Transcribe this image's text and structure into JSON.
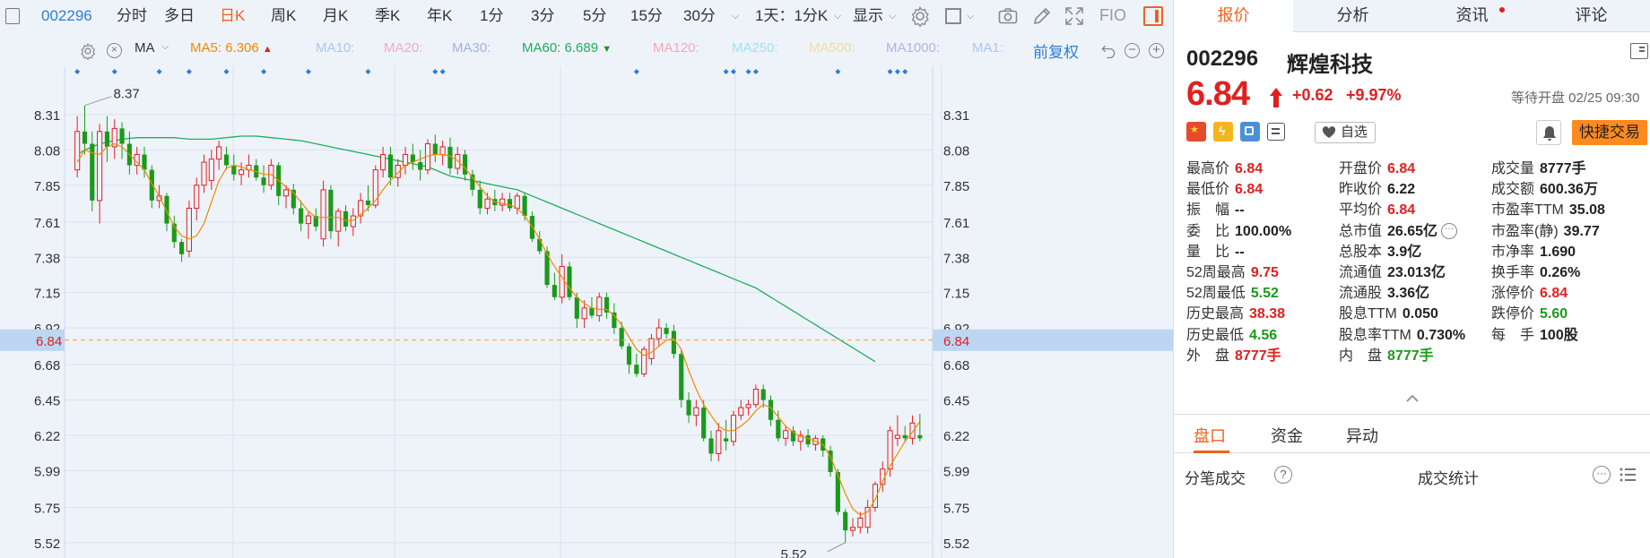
{
  "toolbar": {
    "code": "002296",
    "periods": [
      "分时",
      "多日",
      "日K",
      "周K",
      "月K",
      "季K",
      "年K",
      "1分",
      "3分",
      "5分",
      "15分",
      "30分"
    ],
    "active_period": "日K",
    "span_label": "1天：1分K",
    "display_label": "显示",
    "fio_label": "FIO"
  },
  "ma_row": {
    "label": "MA",
    "items": [
      {
        "label": "MA5:",
        "value": "6.306",
        "color": "#f08a00",
        "trend": "up"
      },
      {
        "label": "MA10:",
        "value": "",
        "color": "#a9c8ee"
      },
      {
        "label": "MA20:",
        "value": "",
        "color": "#f2a8c8"
      },
      {
        "label": "MA30:",
        "value": "",
        "color": "#9fb4dc"
      },
      {
        "label": "MA60:",
        "value": "6.689",
        "color": "#1fae5c",
        "trend": "down"
      },
      {
        "label": "MA120:",
        "value": "",
        "color": "#f2a8b8"
      },
      {
        "label": "MA250:",
        "value": "",
        "color": "#a0e0f0"
      },
      {
        "label": "MA500:",
        "value": "",
        "color": "#f0dca0"
      },
      {
        "label": "MA1000:",
        "value": "",
        "color": "#b8b0e0"
      },
      {
        "label": "MA1:",
        "value": "",
        "color": "#a9c8ee"
      }
    ],
    "adjust_label": "前复权"
  },
  "chart_data": {
    "type": "candlestick",
    "y_ticks": [
      "8.31",
      "8.08",
      "7.85",
      "7.61",
      "7.38",
      "7.15",
      "6.92",
      "6.68",
      "6.45",
      "6.22",
      "5.99",
      "5.75",
      "5.52"
    ],
    "ylim": [
      5.42,
      8.45
    ],
    "current_price": "6.84",
    "high_marker": "8.37",
    "low_marker": "5.52",
    "grid": true,
    "up_color": "#e02020",
    "down_color": "#1a9a1a",
    "candles": [
      {
        "o": 7.95,
        "h": 8.3,
        "l": 7.9,
        "c": 8.2
      },
      {
        "o": 8.2,
        "h": 8.37,
        "l": 8.05,
        "c": 8.12
      },
      {
        "o": 8.12,
        "h": 8.2,
        "l": 7.68,
        "c": 7.75
      },
      {
        "o": 7.75,
        "h": 8.25,
        "l": 7.6,
        "c": 8.2
      },
      {
        "o": 8.2,
        "h": 8.3,
        "l": 8.0,
        "c": 8.1
      },
      {
        "o": 8.1,
        "h": 8.28,
        "l": 8.02,
        "c": 8.22
      },
      {
        "o": 8.22,
        "h": 8.26,
        "l": 8.02,
        "c": 8.12
      },
      {
        "o": 8.12,
        "h": 8.2,
        "l": 7.92,
        "c": 7.98
      },
      {
        "o": 7.98,
        "h": 8.1,
        "l": 7.92,
        "c": 8.05
      },
      {
        "o": 8.05,
        "h": 8.1,
        "l": 7.9,
        "c": 7.95
      },
      {
        "o": 7.95,
        "h": 7.98,
        "l": 7.7,
        "c": 7.75
      },
      {
        "o": 7.75,
        "h": 7.85,
        "l": 7.7,
        "c": 7.78
      },
      {
        "o": 7.78,
        "h": 7.8,
        "l": 7.55,
        "c": 7.6
      },
      {
        "o": 7.6,
        "h": 7.65,
        "l": 7.44,
        "c": 7.48
      },
      {
        "o": 7.48,
        "h": 7.5,
        "l": 7.35,
        "c": 7.4
      },
      {
        "o": 7.42,
        "h": 7.75,
        "l": 7.38,
        "c": 7.7
      },
      {
        "o": 7.7,
        "h": 7.9,
        "l": 7.62,
        "c": 7.85
      },
      {
        "o": 7.85,
        "h": 8.05,
        "l": 7.8,
        "c": 8.0
      },
      {
        "o": 7.88,
        "h": 8.08,
        "l": 7.82,
        "c": 8.02
      },
      {
        "o": 8.02,
        "h": 8.14,
        "l": 7.95,
        "c": 8.1
      },
      {
        "o": 8.05,
        "h": 8.1,
        "l": 7.95,
        "c": 7.98
      },
      {
        "o": 7.98,
        "h": 8.05,
        "l": 7.88,
        "c": 7.92
      },
      {
        "o": 7.92,
        "h": 8.0,
        "l": 7.85,
        "c": 7.95
      },
      {
        "o": 7.95,
        "h": 8.05,
        "l": 7.9,
        "c": 7.98
      },
      {
        "o": 7.98,
        "h": 8.02,
        "l": 7.88,
        "c": 7.9
      },
      {
        "o": 7.9,
        "h": 7.98,
        "l": 7.8,
        "c": 7.85
      },
      {
        "o": 7.85,
        "h": 8.02,
        "l": 7.82,
        "c": 7.98
      },
      {
        "o": 7.98,
        "h": 8.0,
        "l": 7.72,
        "c": 7.78
      },
      {
        "o": 7.78,
        "h": 7.85,
        "l": 7.7,
        "c": 7.82
      },
      {
        "o": 7.82,
        "h": 7.86,
        "l": 7.66,
        "c": 7.7
      },
      {
        "o": 7.7,
        "h": 7.75,
        "l": 7.55,
        "c": 7.6
      },
      {
        "o": 7.6,
        "h": 7.68,
        "l": 7.5,
        "c": 7.65
      },
      {
        "o": 7.65,
        "h": 7.7,
        "l": 7.55,
        "c": 7.58
      },
      {
        "o": 7.5,
        "h": 7.88,
        "l": 7.45,
        "c": 7.82
      },
      {
        "o": 7.82,
        "h": 7.85,
        "l": 7.5,
        "c": 7.55
      },
      {
        "o": 7.55,
        "h": 7.7,
        "l": 7.45,
        "c": 7.68
      },
      {
        "o": 7.68,
        "h": 7.72,
        "l": 7.55,
        "c": 7.58
      },
      {
        "o": 7.58,
        "h": 7.7,
        "l": 7.52,
        "c": 7.65
      },
      {
        "o": 7.65,
        "h": 7.8,
        "l": 7.6,
        "c": 7.75
      },
      {
        "o": 7.75,
        "h": 7.85,
        "l": 7.68,
        "c": 7.72
      },
      {
        "o": 7.72,
        "h": 7.98,
        "l": 7.7,
        "c": 7.95
      },
      {
        "o": 7.95,
        "h": 8.1,
        "l": 7.9,
        "c": 8.05
      },
      {
        "o": 8.05,
        "h": 8.1,
        "l": 7.85,
        "c": 7.9
      },
      {
        "o": 7.9,
        "h": 8.02,
        "l": 7.84,
        "c": 7.98
      },
      {
        "o": 7.98,
        "h": 8.1,
        "l": 7.92,
        "c": 8.05
      },
      {
        "o": 8.05,
        "h": 8.12,
        "l": 7.95,
        "c": 8.0
      },
      {
        "o": 8.0,
        "h": 8.08,
        "l": 7.88,
        "c": 7.95
      },
      {
        "o": 7.95,
        "h": 8.15,
        "l": 7.92,
        "c": 8.12
      },
      {
        "o": 8.12,
        "h": 8.18,
        "l": 8.0,
        "c": 8.05
      },
      {
        "o": 8.05,
        "h": 8.14,
        "l": 7.98,
        "c": 8.1
      },
      {
        "o": 8.1,
        "h": 8.16,
        "l": 7.92,
        "c": 7.96
      },
      {
        "o": 7.96,
        "h": 8.1,
        "l": 7.92,
        "c": 8.05
      },
      {
        "o": 8.05,
        "h": 8.08,
        "l": 7.88,
        "c": 7.92
      },
      {
        "o": 7.92,
        "h": 7.95,
        "l": 7.78,
        "c": 7.82
      },
      {
        "o": 7.82,
        "h": 7.88,
        "l": 7.66,
        "c": 7.7
      },
      {
        "o": 7.7,
        "h": 7.8,
        "l": 7.66,
        "c": 7.76
      },
      {
        "o": 7.76,
        "h": 7.82,
        "l": 7.68,
        "c": 7.72
      },
      {
        "o": 7.72,
        "h": 7.8,
        "l": 7.68,
        "c": 7.76
      },
      {
        "o": 7.76,
        "h": 7.8,
        "l": 7.68,
        "c": 7.7
      },
      {
        "o": 7.7,
        "h": 7.8,
        "l": 7.66,
        "c": 7.78
      },
      {
        "o": 7.78,
        "h": 7.8,
        "l": 7.62,
        "c": 7.65
      },
      {
        "o": 7.65,
        "h": 7.68,
        "l": 7.48,
        "c": 7.5
      },
      {
        "o": 7.5,
        "h": 7.55,
        "l": 7.4,
        "c": 7.42
      },
      {
        "o": 7.42,
        "h": 7.45,
        "l": 7.18,
        "c": 7.2
      },
      {
        "o": 7.2,
        "h": 7.28,
        "l": 7.1,
        "c": 7.12
      },
      {
        "o": 7.12,
        "h": 7.4,
        "l": 7.08,
        "c": 7.32
      },
      {
        "o": 7.32,
        "h": 7.35,
        "l": 7.1,
        "c": 7.12
      },
      {
        "o": 7.12,
        "h": 7.15,
        "l": 6.92,
        "c": 6.98
      },
      {
        "o": 6.98,
        "h": 7.1,
        "l": 6.92,
        "c": 7.05
      },
      {
        "o": 7.05,
        "h": 7.12,
        "l": 6.98,
        "c": 7.0
      },
      {
        "o": 7.0,
        "h": 7.15,
        "l": 6.96,
        "c": 7.12
      },
      {
        "o": 7.12,
        "h": 7.15,
        "l": 6.98,
        "c": 7.02
      },
      {
        "o": 7.02,
        "h": 7.08,
        "l": 6.88,
        "c": 6.92
      },
      {
        "o": 6.92,
        "h": 6.96,
        "l": 6.78,
        "c": 6.8
      },
      {
        "o": 6.8,
        "h": 6.82,
        "l": 6.62,
        "c": 6.68
      },
      {
        "o": 6.68,
        "h": 6.75,
        "l": 6.6,
        "c": 6.62
      },
      {
        "o": 6.62,
        "h": 6.8,
        "l": 6.6,
        "c": 6.78
      },
      {
        "o": 6.72,
        "h": 6.88,
        "l": 6.68,
        "c": 6.85
      },
      {
        "o": 6.85,
        "h": 6.98,
        "l": 6.8,
        "c": 6.92
      },
      {
        "o": 6.92,
        "h": 6.95,
        "l": 6.85,
        "c": 6.88
      },
      {
        "o": 6.9,
        "h": 6.94,
        "l": 6.72,
        "c": 6.75
      },
      {
        "o": 6.75,
        "h": 6.78,
        "l": 6.4,
        "c": 6.45
      },
      {
        "o": 6.45,
        "h": 6.5,
        "l": 6.3,
        "c": 6.35
      },
      {
        "o": 6.35,
        "h": 6.45,
        "l": 6.28,
        "c": 6.4
      },
      {
        "o": 6.4,
        "h": 6.45,
        "l": 6.18,
        "c": 6.2
      },
      {
        "o": 6.2,
        "h": 6.25,
        "l": 6.05,
        "c": 6.1
      },
      {
        "o": 6.1,
        "h": 6.3,
        "l": 6.05,
        "c": 6.25
      },
      {
        "o": 6.2,
        "h": 6.32,
        "l": 6.12,
        "c": 6.18
      },
      {
        "o": 6.18,
        "h": 6.38,
        "l": 6.15,
        "c": 6.35
      },
      {
        "o": 6.35,
        "h": 6.45,
        "l": 6.32,
        "c": 6.4
      },
      {
        "o": 6.4,
        "h": 6.45,
        "l": 6.35,
        "c": 6.42
      },
      {
        "o": 6.42,
        "h": 6.55,
        "l": 6.4,
        "c": 6.52
      },
      {
        "o": 6.52,
        "h": 6.55,
        "l": 6.4,
        "c": 6.45
      },
      {
        "o": 6.45,
        "h": 6.48,
        "l": 6.28,
        "c": 6.32
      },
      {
        "o": 6.32,
        "h": 6.38,
        "l": 6.18,
        "c": 6.2
      },
      {
        "o": 6.2,
        "h": 6.28,
        "l": 6.15,
        "c": 6.25
      },
      {
        "o": 6.25,
        "h": 6.28,
        "l": 6.15,
        "c": 6.18
      },
      {
        "o": 6.18,
        "h": 6.25,
        "l": 6.12,
        "c": 6.22
      },
      {
        "o": 6.22,
        "h": 6.26,
        "l": 6.14,
        "c": 6.16
      },
      {
        "o": 6.16,
        "h": 6.22,
        "l": 6.12,
        "c": 6.2
      },
      {
        "o": 6.2,
        "h": 6.22,
        "l": 6.08,
        "c": 6.12
      },
      {
        "o": 6.12,
        "h": 6.15,
        "l": 5.95,
        "c": 5.98
      },
      {
        "o": 5.98,
        "h": 6.0,
        "l": 5.7,
        "c": 5.72
      },
      {
        "o": 5.72,
        "h": 5.74,
        "l": 5.52,
        "c": 5.6
      },
      {
        "o": 5.6,
        "h": 5.68,
        "l": 5.56,
        "c": 5.62
      },
      {
        "o": 5.62,
        "h": 5.72,
        "l": 5.58,
        "c": 5.68
      },
      {
        "o": 5.62,
        "h": 5.8,
        "l": 5.58,
        "c": 5.75
      },
      {
        "o": 5.75,
        "h": 5.92,
        "l": 5.72,
        "c": 5.9
      },
      {
        "o": 5.9,
        "h": 6.05,
        "l": 5.85,
        "c": 6.0
      },
      {
        "o": 6.0,
        "h": 6.28,
        "l": 5.95,
        "c": 6.25
      },
      {
        "o": 6.2,
        "h": 6.35,
        "l": 6.15,
        "c": 6.22
      },
      {
        "o": 6.22,
        "h": 6.28,
        "l": 6.18,
        "c": 6.2
      },
      {
        "o": 6.2,
        "h": 6.35,
        "l": 6.16,
        "c": 6.3
      },
      {
        "o": 6.22,
        "h": 6.36,
        "l": 6.18,
        "c": 6.2
      }
    ],
    "ma5": [
      8.0,
      8.08,
      8.06,
      8.05,
      8.1,
      8.12,
      8.1,
      8.05,
      8.0,
      7.95,
      7.86,
      7.78,
      7.68,
      7.58,
      7.52,
      7.5,
      7.52,
      7.6,
      7.74,
      7.88,
      7.96,
      7.98,
      7.97,
      7.95,
      7.94,
      7.92,
      7.92,
      7.88,
      7.84,
      7.8,
      7.74,
      7.68,
      7.64,
      7.64,
      7.64,
      7.64,
      7.62,
      7.62,
      7.66,
      7.7,
      7.75,
      7.82,
      7.88,
      7.93,
      7.98,
      8.0,
      8.02,
      8.04,
      8.05,
      8.05,
      8.04,
      8.01,
      7.96,
      7.9,
      7.84,
      7.78,
      7.74,
      7.73,
      7.72,
      7.7,
      7.65,
      7.58,
      7.5,
      7.4,
      7.32,
      7.25,
      7.18,
      7.12,
      7.08,
      7.05,
      7.04,
      7.04,
      7.0,
      6.94,
      6.86,
      6.78,
      6.74,
      6.76,
      6.8,
      6.84,
      6.85,
      6.78,
      6.64,
      6.52,
      6.42,
      6.35,
      6.28,
      6.25,
      6.25,
      6.28,
      6.32,
      6.38,
      6.42,
      6.4,
      6.34,
      6.28,
      6.24,
      6.21,
      6.2,
      6.18,
      6.16,
      6.08,
      5.96,
      5.84,
      5.74,
      5.7,
      5.72,
      5.8,
      5.92,
      6.02,
      6.1,
      6.18,
      6.24,
      6.31
    ],
    "ma60": [
      8.05,
      8.08,
      8.1,
      8.12,
      8.13,
      8.14,
      8.15,
      8.155,
      8.16,
      8.16,
      8.16,
      8.16,
      8.16,
      8.16,
      8.155,
      8.15,
      8.15,
      8.15,
      8.15,
      8.155,
      8.16,
      8.165,
      8.17,
      8.17,
      8.17,
      8.165,
      8.16,
      8.155,
      8.15,
      8.145,
      8.14,
      8.13,
      8.12,
      8.11,
      8.1,
      8.09,
      8.08,
      8.07,
      8.06,
      8.05,
      8.04,
      8.03,
      8.02,
      8.01,
      8.0,
      7.99,
      7.98,
      7.97,
      7.95,
      7.93,
      7.91,
      7.9,
      7.89,
      7.88,
      7.87,
      7.86,
      7.85,
      7.84,
      7.83,
      7.82,
      7.8,
      7.78,
      7.76,
      7.74,
      7.72,
      7.7,
      7.68,
      7.66,
      7.64,
      7.62,
      7.6,
      7.58,
      7.56,
      7.54,
      7.52,
      7.5,
      7.48,
      7.46,
      7.44,
      7.42,
      7.4,
      7.38,
      7.36,
      7.34,
      7.32,
      7.3,
      7.28,
      7.26,
      7.24,
      7.22,
      7.2,
      7.18,
      7.15,
      7.12,
      7.09,
      7.06,
      7.03,
      7.0,
      6.97,
      6.94,
      6.91,
      6.88,
      6.85,
      6.82,
      6.79,
      6.76,
      6.73,
      6.7
    ],
    "event_markers": [
      0,
      5,
      11,
      15,
      20,
      25,
      31,
      39,
      48,
      49,
      75,
      87,
      88,
      90,
      91,
      102,
      109,
      110,
      111
    ]
  },
  "panel": {
    "tabs": [
      "报价",
      "分析",
      "资讯",
      "评论"
    ],
    "active_tab": "报价",
    "code": "002296",
    "name": "辉煌科技",
    "price": "6.84",
    "change": "+0.62",
    "change_pct": "+9.97%",
    "status": "等待开盘 02/25 09:30",
    "watch_label": "自选",
    "trade_label": "快捷交易",
    "quote": [
      [
        {
          "label": "最高价",
          "value": "6.84",
          "tone": "red"
        },
        {
          "label": "开盘价",
          "value": "6.84",
          "tone": "red"
        },
        {
          "label": "成交量",
          "value": "8777手",
          "tone": "dark"
        }
      ],
      [
        {
          "label": "最低价",
          "value": "6.84",
          "tone": "red"
        },
        {
          "label": "昨收价",
          "value": "6.22",
          "tone": "dark"
        },
        {
          "label": "成交额",
          "value": "600.36万",
          "tone": "dark"
        }
      ],
      [
        {
          "label": "振　幅",
          "value": "--",
          "tone": "dark"
        },
        {
          "label": "平均价",
          "value": "6.84",
          "tone": "red"
        },
        {
          "label": "市盈率TTM",
          "value": "35.08",
          "tone": "dark"
        }
      ],
      [
        {
          "label": "委　比",
          "value": "100.00%",
          "tone": "dark"
        },
        {
          "label": "总市值",
          "value": "26.65亿",
          "tone": "dark"
        },
        {
          "label": "市盈率(静)",
          "value": "39.77",
          "tone": "dark"
        }
      ],
      [
        {
          "label": "量　比",
          "value": "--",
          "tone": "dark"
        },
        {
          "label": "总股本",
          "value": "3.9亿",
          "tone": "dark"
        },
        {
          "label": "市净率",
          "value": "1.690",
          "tone": "dark"
        }
      ],
      [
        {
          "label": "52周最高",
          "value": "9.75",
          "tone": "red"
        },
        {
          "label": "流通值",
          "value": "23.013亿",
          "tone": "dark"
        },
        {
          "label": "换手率",
          "value": "0.26%",
          "tone": "dark"
        }
      ],
      [
        {
          "label": "52周最低",
          "value": "5.52",
          "tone": "green"
        },
        {
          "label": "流通股",
          "value": "3.36亿",
          "tone": "dark"
        },
        {
          "label": "涨停价",
          "value": "6.84",
          "tone": "red"
        }
      ],
      [
        {
          "label": "历史最高",
          "value": "38.38",
          "tone": "red"
        },
        {
          "label": "股息TTM",
          "value": "0.050",
          "tone": "dark"
        },
        {
          "label": "跌停价",
          "value": "5.60",
          "tone": "green"
        }
      ],
      [
        {
          "label": "历史最低",
          "value": "4.56",
          "tone": "green"
        },
        {
          "label": "股息率TTM",
          "value": "0.730%",
          "tone": "dark"
        },
        {
          "label": "每　手",
          "value": "100股",
          "tone": "dark"
        }
      ],
      [
        {
          "label": "外　盘",
          "value": "8777手",
          "tone": "red"
        },
        {
          "label": "内　盘",
          "value": "8777手",
          "tone": "green"
        },
        {
          "label": "",
          "value": "",
          "tone": "dark"
        }
      ]
    ],
    "lower_tabs": [
      "盘口",
      "资金",
      "异动"
    ],
    "trades_label": "分笔成交",
    "stats_label": "成交统计"
  }
}
